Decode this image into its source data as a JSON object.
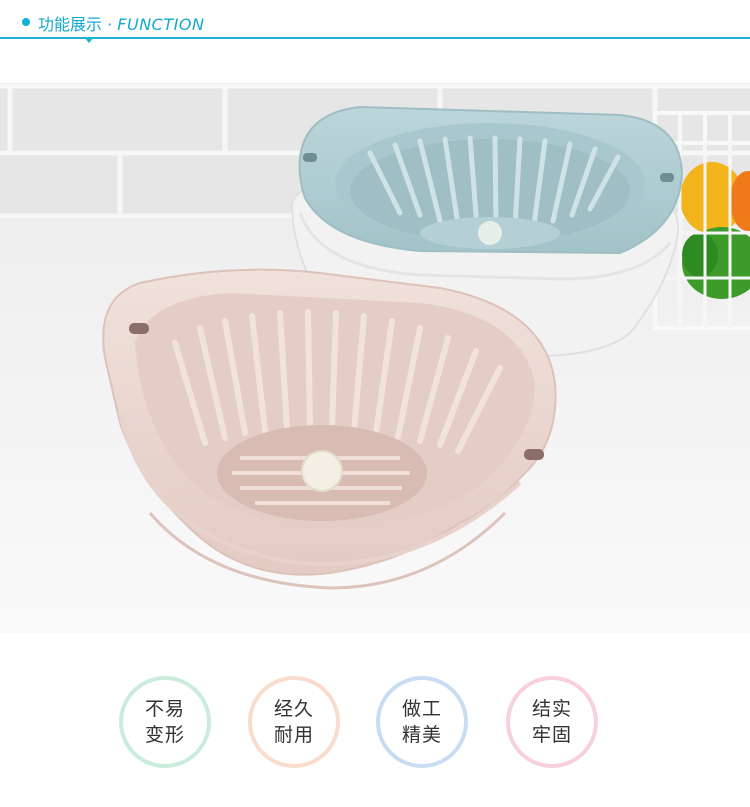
{
  "header": {
    "title_cn": "功能展示",
    "separator": "·",
    "title_en": "FUNCTION",
    "accent_color": "#12a9cf"
  },
  "photo": {
    "colors": {
      "pink_basin": "#eedcd6",
      "blue_basket": "#b3d0d4",
      "white_basin": "#f3f3f3",
      "tile_wall": "#e9e9e9",
      "counter": "#f5f5f5"
    }
  },
  "features": [
    {
      "line1": "不易",
      "line2": "变形",
      "ring_color": "#c9ecdc"
    },
    {
      "line1": "经久",
      "line2": "耐用",
      "ring_color": "#f9dccc"
    },
    {
      "line1": "做工",
      "line2": "精美",
      "ring_color": "#c8ddf3"
    },
    {
      "line1": "结实",
      "line2": "牢固",
      "ring_color": "#f7d0de"
    }
  ]
}
